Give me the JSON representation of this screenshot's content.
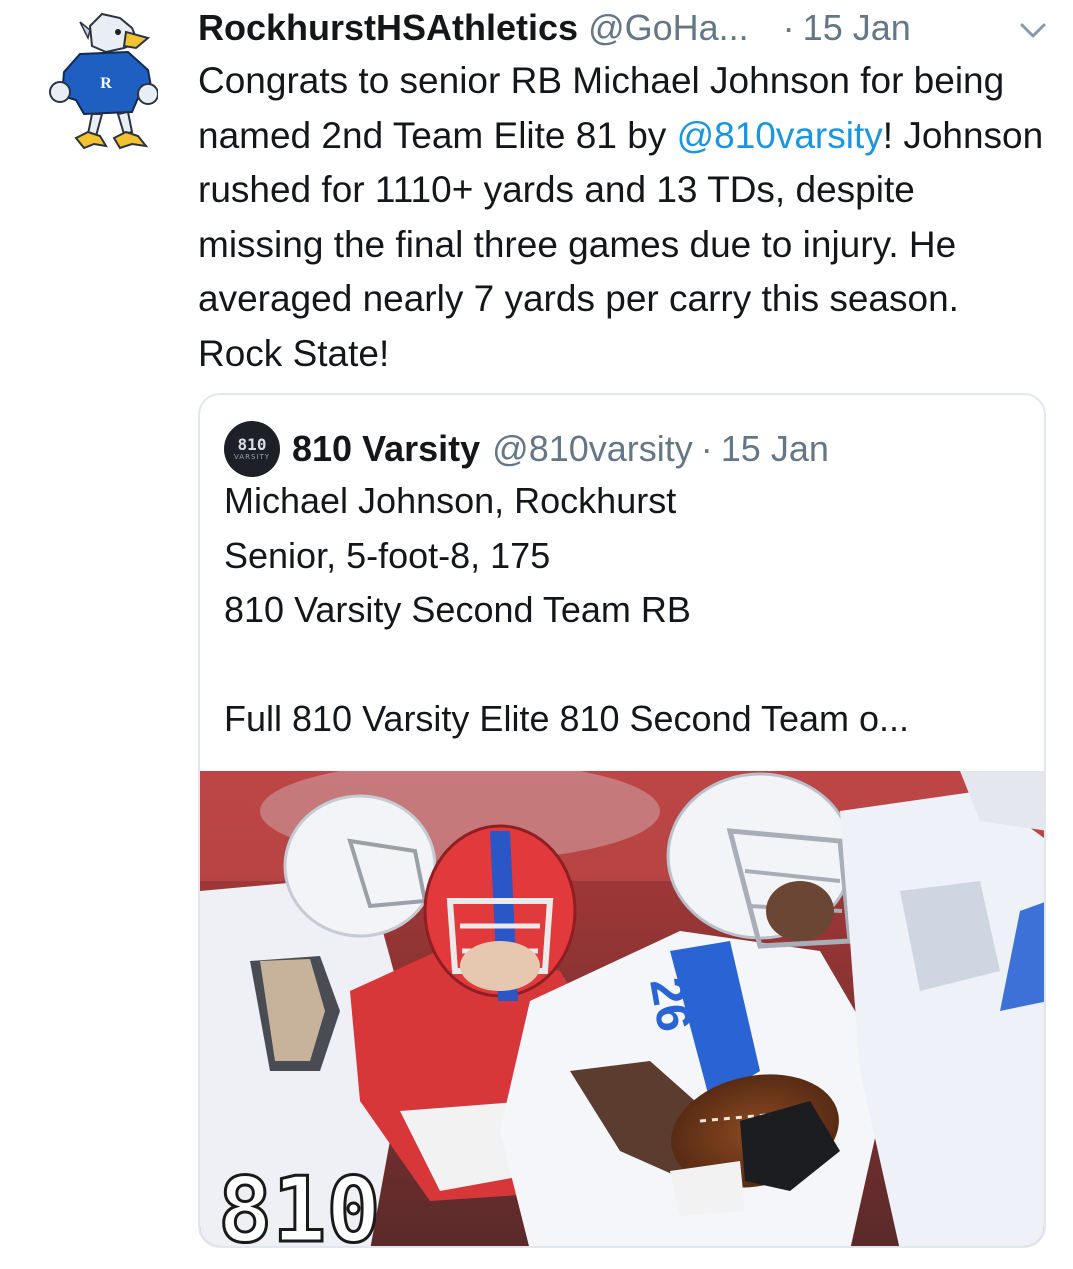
{
  "tweet": {
    "author_name": "RockhurstHSAthletics",
    "author_handle": "@GoHa...",
    "separator": "·",
    "time": "15 Jan",
    "avatar_icon": "hawk-mascot-icon",
    "menu_icon": "chevron-down-icon",
    "text_part1": "Congrats to senior RB Michael Johnson for being named 2nd Team Elite 81 by ",
    "mention": "@810varsity",
    "text_part2": "! Johnson rushed for 1110+ yards and 13 TDs, despite missing the final three games due to injury. He averaged nearly 7 yards per carry this season. Rock State!"
  },
  "quote": {
    "author_name": "810 Varsity",
    "author_handle": "@810varsity",
    "separator": "·",
    "time": "15 Jan",
    "avatar_text_top": "810",
    "avatar_text_bottom": "VARSITY",
    "lines": [
      "Michael Johnson, Rockhurst",
      "Senior, 5-foot-8, 175",
      "810 Varsity Second Team RB",
      "",
      "Full 810 Varsity Elite 810 Second Team o..."
    ],
    "photo": {
      "jersey_number": "26",
      "watermark": "810"
    }
  },
  "colors": {
    "link": "#1b95e0",
    "secondary_text": "#657786",
    "primary_text": "#14171a",
    "border": "#e1e8ed"
  }
}
